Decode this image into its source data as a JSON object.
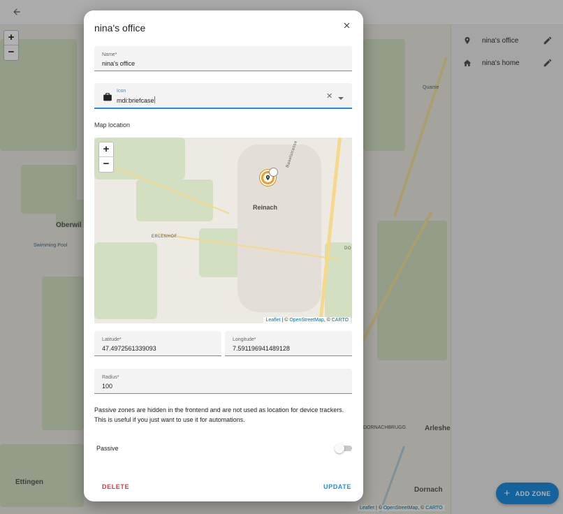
{
  "topbar": {
    "back_icon": "arrow-left-icon"
  },
  "background_map": {
    "zoom_in": "+",
    "zoom_out": "−",
    "labels": {
      "oberwil": "Oberwil",
      "swimming_pool": "Swimming Pool",
      "ettingen": "Ettingen",
      "arlesheim": "Arleshei",
      "dornach": "Dornach",
      "dornachbrugg": "DORNACHBRUGG",
      "quarrie": "Quarrie"
    },
    "attribution": {
      "leaflet": "Leaflet",
      "sep": " | © ",
      "osm": "OpenStreetMap",
      "comma": ", © ",
      "carto": "CARTO"
    }
  },
  "side_panel": {
    "zones": [
      {
        "icon": "map-marker-icon",
        "label": "nina's office"
      },
      {
        "icon": "home-icon",
        "label": "nina's home"
      }
    ],
    "edit_icon": "pencil-icon"
  },
  "fab": {
    "label": "ADD ZONE",
    "icon": "+"
  },
  "dialog": {
    "title": "nina's office",
    "close_icon": "×",
    "name_field": {
      "label": "Name*",
      "value": "nina's office"
    },
    "icon_field": {
      "label": "Icon",
      "value": "mdi:briefcase",
      "clear_icon": "✕"
    },
    "map_section_label": "Map location",
    "map": {
      "zoom_in": "+",
      "zoom_out": "−",
      "town_label": "Reinach",
      "district_label": "ERLENHOF",
      "street_label": "Baselstrasse",
      "edge_label": "DO",
      "attribution": {
        "leaflet": "Leaflet",
        "sep": " | © ",
        "osm": "OpenStreetMap",
        "comma": ", © ",
        "carto": "CARTO"
      }
    },
    "latitude": {
      "label": "Latitude*",
      "value": "47.4972561339093"
    },
    "longitude": {
      "label": "Longitude*",
      "value": "7.591196941489128"
    },
    "radius": {
      "label": "Radius*",
      "value": "100"
    },
    "description": "Passive zones are hidden in the frontend and are not used as location for device trackers. This is useful if you just want to use it for automations.",
    "passive": {
      "label": "Passive",
      "enabled": false
    },
    "delete_label": "DELETE",
    "update_label": "UPDATE"
  },
  "colors": {
    "accent": "#1e8fe0",
    "danger": "#d13a3a",
    "marker": "#f39c1f"
  }
}
